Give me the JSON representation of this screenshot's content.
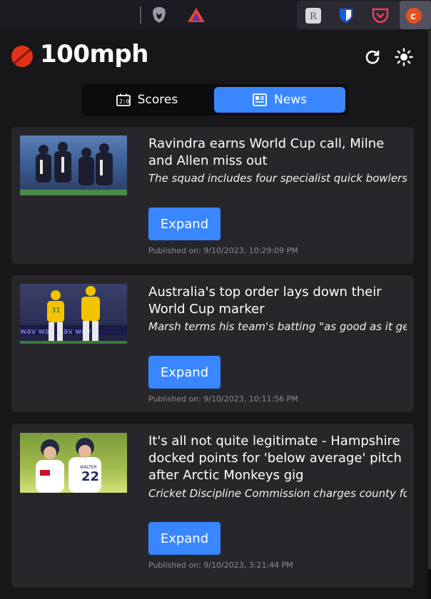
{
  "browser": {
    "toolbar_icons": [
      "brave-lion-icon",
      "triangle-icon"
    ],
    "extensions": [
      "readwise-icon",
      "bitwarden-icon",
      "pocket-icon",
      "100mph-extension-icon"
    ]
  },
  "app": {
    "name": "100mph",
    "logo_icon": "cricket-ball-icon",
    "refresh_icon": "refresh-icon",
    "theme_icon": "sun-icon"
  },
  "tabs": {
    "scores": "Scores",
    "news": "News",
    "active": "news"
  },
  "news": [
    {
      "title": "Ravindra earns World Cup call, Milne and Allen miss out",
      "description": "The squad includes four specialist quick bowlers while Jimmy Neesham is also",
      "expand_label": "Expand",
      "published": "Published on: 9/10/2023, 10:29:09 PM"
    },
    {
      "title": "Australia's top order lays down their World Cup marker",
      "description": "Marsh terms his team's batting \"as good as it gets\" after Head blazes away followed by",
      "expand_label": "Expand",
      "published": "Published on: 9/10/2023, 10:11:56 PM"
    },
    {
      "title": "It's all not quite legitimate - Hampshire docked points for 'below average' pitch after Arctic Monkeys gig",
      "description": "Cricket Discipline Commission charges county for breaching pitch regulations in July",
      "expand_label": "Expand",
      "published": "Published on: 9/10/2023, 3:21:44 PM"
    }
  ],
  "thumb_texts": {
    "card3_shirt_number": "22",
    "card3_shirt_name": "WALTER"
  },
  "colors": {
    "accent": "#3a86ff",
    "card": "#27272b",
    "background": "#17171a"
  }
}
